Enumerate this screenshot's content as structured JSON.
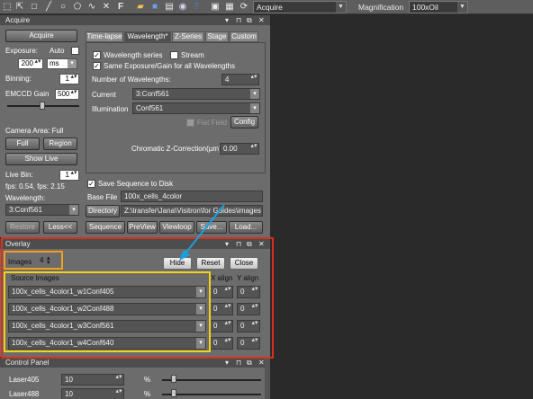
{
  "toolbar": {
    "icons": [
      "select-icon",
      "zoom-icon",
      "rectangle-icon",
      "line-icon",
      "ellipse-icon",
      "polygon-icon",
      "freehand-icon",
      "text-icon",
      "open-folder-icon",
      "save-icon",
      "print-icon",
      "camera-icon",
      "help-icon",
      "region-icon",
      "layout-icon",
      "refresh-icon"
    ],
    "mode_value": "Acquire",
    "magnification_label": "Magnification",
    "magnification_value": "100xOil"
  },
  "acquire": {
    "title": "Acquire",
    "acquire_button": "Acquire",
    "exposure_label": "Exposure:",
    "auto_label": "Auto",
    "exposure_value": "200",
    "exposure_unit": "ms",
    "binning_label": "Binning:",
    "binning_value": "1",
    "gain_label": "EMCCD Gain",
    "gain_value": "500",
    "camera_area_label": "Camera Area: Full",
    "full_button": "Full",
    "region_button": "Region",
    "show_live_button": "Show Live",
    "live_bin_label": "Live Bin:",
    "live_bin_value": "1",
    "fps_text": "fps: 0.54, fps: 2.15",
    "wavelength_label": "Wavelength:",
    "wavelength_value": "3:Conf561",
    "restore_button": "Restore",
    "less_button": "Less<<",
    "tabs": [
      "Time-lapse",
      "Wavelength*",
      "Z-Series",
      "Stage",
      "Custom"
    ],
    "wavelength_series_label": "Wavelength series",
    "stream_label": "Stream",
    "same_exposure_label": "Same Exposure/Gain for all Wavelengths",
    "num_wavelengths_label": "Number of Wavelengths:",
    "num_wavelengths_value": "4",
    "current_label": "Current",
    "current_value": "3:Conf561",
    "illumination_label": "Illumination",
    "illumination_value": "Conf561",
    "flat_field_label": "Flat Field",
    "config_button": "Config",
    "chromatic_label": "Chromatic Z-Correction(µm):",
    "chromatic_value": "0.00",
    "save_sequence_label": "Save Sequence to Disk",
    "base_file_label": "Base File",
    "base_file_value": "100x_cells_4color",
    "directory_button": "Directory",
    "directory_value": "Z:\\transfer\\Jana\\Visitron\\for Guides\\images an",
    "sequence_button": "Sequence",
    "preview_button": "PreView",
    "viewloop_button": "Viewloop",
    "save_button": "Save...",
    "load_button": "Load..."
  },
  "overlay": {
    "title": "Overlay",
    "images_label": "Images",
    "images_value": "4",
    "hide_button": "Hide",
    "reset_button": "Reset",
    "close_button": "Close",
    "source_images_label": "Source Images",
    "x_align_label": "X align",
    "y_align_label": "Y align",
    "rows": [
      {
        "name": "100x_cells_4color1_w1Conf405",
        "x": "0",
        "y": "0"
      },
      {
        "name": "100x_cells_4color1_w2Conf488",
        "x": "0",
        "y": "0"
      },
      {
        "name": "100x_cells_4color1_w3Conf561",
        "x": "0",
        "y": "0"
      },
      {
        "name": "100x_cells_4color1_w4Conf640",
        "x": "0",
        "y": "0"
      }
    ]
  },
  "control_panel": {
    "title": "Control Panel",
    "rows": [
      {
        "label": "Laser405",
        "value": "10",
        "unit": "%"
      },
      {
        "label": "Laser488",
        "value": "10",
        "unit": "%"
      }
    ]
  },
  "colors": {
    "red_highlight": "#d9301e",
    "orange_highlight": "#f0a020",
    "yellow_highlight": "#f4d21a",
    "arrow": "#1aa0e0"
  }
}
